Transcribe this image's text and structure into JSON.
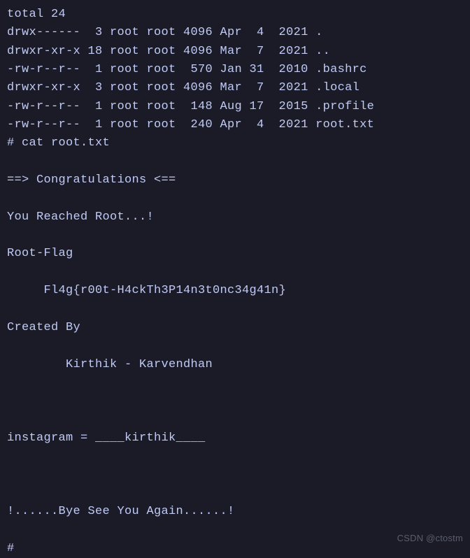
{
  "terminal": {
    "lines": [
      "total 24",
      "drwx------  3 root root 4096 Apr  4  2021 .",
      "drwxr-xr-x 18 root root 4096 Mar  7  2021 ..",
      "-rw-r--r--  1 root root  570 Jan 31  2010 .bashrc",
      "drwxr-xr-x  3 root root 4096 Mar  7  2021 .local",
      "-rw-r--r--  1 root root  148 Aug 17  2015 .profile",
      "-rw-r--r--  1 root root  240 Apr  4  2021 root.txt",
      "# cat root.txt",
      "",
      "==> Congratulations <==",
      "",
      "You Reached Root...!",
      "",
      "Root-Flag ",
      "",
      "     Fl4g{r00t-H4ckTh3P14n3t0nc34g41n}",
      "",
      "Created By ",
      "",
      "        Kirthik - Karvendhan",
      "",
      "",
      "",
      "instagram = ____kirthik____",
      "",
      "",
      "",
      "!......Bye See You Again......!",
      "",
      "# "
    ]
  },
  "watermark": "CSDN @ctostm"
}
